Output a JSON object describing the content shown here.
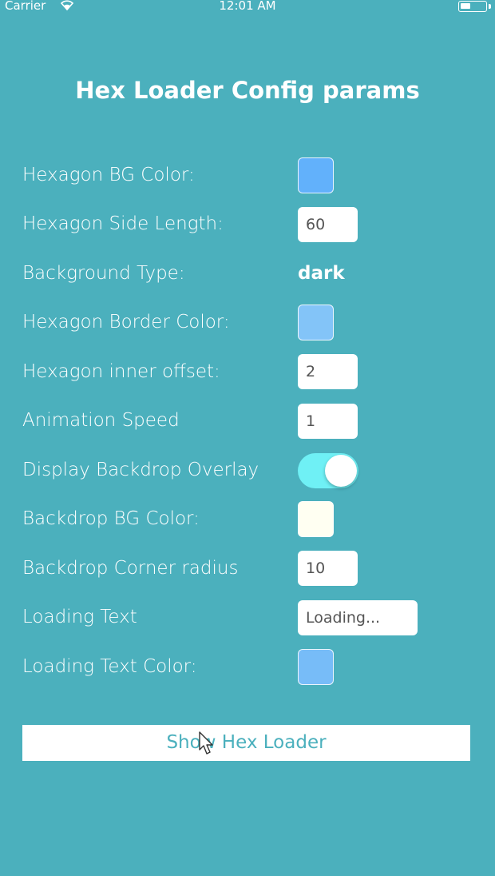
{
  "status_bar": {
    "carrier": "Carrier",
    "time": "12:01 AM",
    "battery_level": 0.4
  },
  "title": "Hex Loader Config params",
  "rows": {
    "hex_bg_color": {
      "label": "Hexagon BG Color:",
      "color": "#62b1fb"
    },
    "hex_side_length": {
      "label": "Hexagon Side Length:",
      "value": "60"
    },
    "background_type": {
      "label": "Background Type:",
      "value": "dark"
    },
    "hex_border_color": {
      "label": "Hexagon Border Color:",
      "color": "#83c4f8"
    },
    "hex_inner_offset": {
      "label": "Hexagon inner offset:",
      "value": "2"
    },
    "animation_speed": {
      "label": "Animation Speed",
      "value": "1"
    },
    "backdrop_overlay": {
      "label": "Display Backdrop Overlay",
      "on": true,
      "track_color": "#6ff0f5"
    },
    "backdrop_bg_color": {
      "label": "Backdrop BG Color:",
      "color": "#fffff2"
    },
    "backdrop_corner_radius": {
      "label": "Backdrop Corner radius",
      "value": "10"
    },
    "loading_text": {
      "label": "Loading Text",
      "value": "Loading..."
    },
    "loading_text_color": {
      "label": "Loading Text Color:",
      "color": "#77bcf8"
    }
  },
  "show_button_label": "Show Hex Loader",
  "colors": {
    "background": "#4bb0bd",
    "button_text": "#4bb0bd"
  }
}
